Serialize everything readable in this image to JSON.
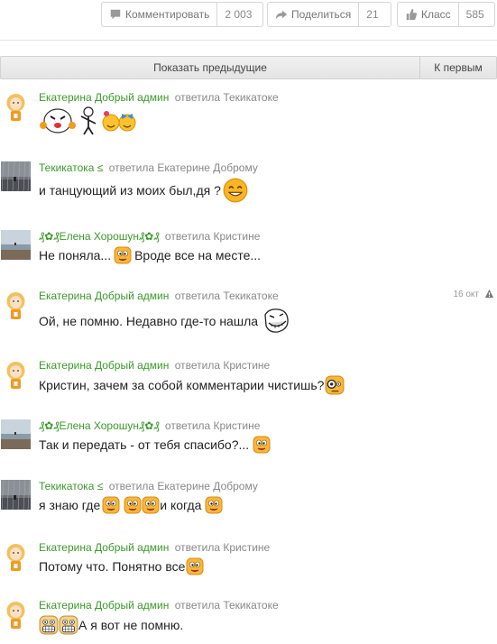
{
  "actions": {
    "comment": {
      "label": "Комментировать",
      "count": "2 003"
    },
    "share": {
      "label": "Поделиться",
      "count": "21"
    },
    "class": {
      "label": "Класс",
      "count": "585"
    }
  },
  "prev": {
    "show_label": "Показать предыдущие",
    "first_label": "К первым"
  },
  "comments": [
    {
      "author": "Екатерина Добрый админ",
      "replied": "ответила Текикатоке",
      "text": ""
    },
    {
      "author": "Текикатока ≤",
      "replied": "ответила Екатерине Доброму",
      "text": "и танцующий из моих был,дя ?"
    },
    {
      "author": "₰✿₰Елена Хорошун₰✿₰",
      "replied": "ответила Кристине",
      "text1": "Не поняла...",
      "text2": "Вроде все на месте..."
    },
    {
      "author": "Екатерина Добрый админ",
      "replied": "ответила Текикатоке",
      "text": "Ой, не помню. Недавно где-то нашла",
      "date": "16 окт"
    },
    {
      "author": "Екатерина Добрый админ",
      "replied": "ответила Кристине",
      "text": "Кристин, зачем за собой комментарии чистишь?"
    },
    {
      "author": "₰✿₰Елена Хорошун₰✿₰",
      "replied": "ответила Кристине",
      "text": "Так и передать - от тебя спасибо?..."
    },
    {
      "author": "Текикатока ≤",
      "replied": "ответила Екатерине Доброму",
      "text1": "я знаю где",
      "text2": "и когда"
    },
    {
      "author": "Екатерина Добрый админ",
      "replied": "ответила Кристине",
      "text": "Потому что. Понятно все"
    },
    {
      "author": "Екатерина Добрый админ",
      "replied": "ответила Текикатоке",
      "text": "А я вот не помню."
    }
  ]
}
